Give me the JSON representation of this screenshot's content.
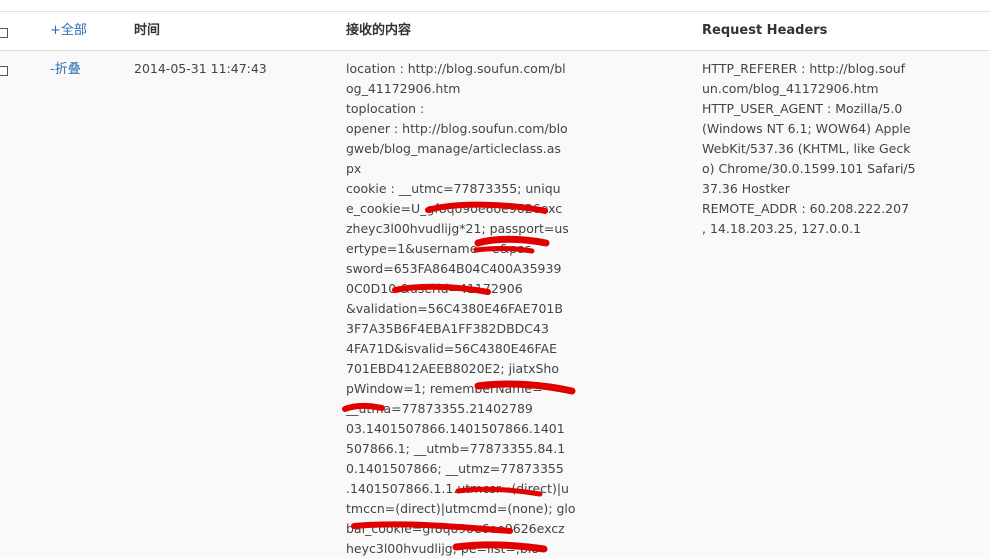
{
  "table": {
    "header": {
      "toggle_all": "+全部",
      "time": "时间",
      "content": "接收的内容",
      "headers": "Request Headers"
    },
    "row": {
      "toggle": "-折叠",
      "time": "2014-05-31 11:47:43",
      "content_lines": [
        "location : http://blog.soufun.com/bl",
        "og_41172906.htm",
        "toplocation :",
        "opener : http://blog.soufun.com/blo",
        "gweb/blog_manage/articleclass.as",
        "px",
        "cookie : __utmc=77873355; uniqu",
        "e_cookie=U_gf8qo9oe6oe9626exc",
        "zheyc3l00hvudlijg*21; passport=us",
        "ertype=1&username=        e&pas",
        "sword=653FA864B04C400A35939",
        "0C0D10     &userid=41172906",
        "&validation=56C4380E46FAE701B",
        "3F7A35B6F4EBA1FF382DBDC43",
        "4FA71D&isvalid=56C4380E46FAE",
        "701EBD412AEEB8020E2; jiatxSho",
        "pWindow=1; rememberName=       ",
        "    __utma=77873355.21402789",
        "03.1401507866.1401507866.1401",
        "507866.1; __utmb=77873355.84.1",
        "0.1401507866; __utmz=77873355",
        ".1401507866.1.1.utmcsr=(direct)|u",
        "tmccn=(direct)|utmcmd=(none); glo",
        "bal_cookie=gf8qo9oe6oe9626excz",
        "heyc3l00hvudlijg;        pe=list=,blo"
      ],
      "header_lines": [
        "HTTP_REFERER : http://blog.souf",
        "un.com/blog_41172906.htm",
        "HTTP_USER_AGENT : Mozilla/5.0",
        "(Windows NT 6.1; WOW64) Apple",
        "WebKit/537.36 (KHTML, like Geck",
        "o) Chrome/30.0.1599.101 Safari/5",
        "37.36 Hostker",
        "REMOTE_ADDR : 60.208.222.207",
        ", 14.18.203.25, 127.0.0.1"
      ]
    }
  },
  "colors": {
    "link": "#2a6fb5",
    "redaction": "#e00000",
    "row_background": "#f9f9f9"
  }
}
